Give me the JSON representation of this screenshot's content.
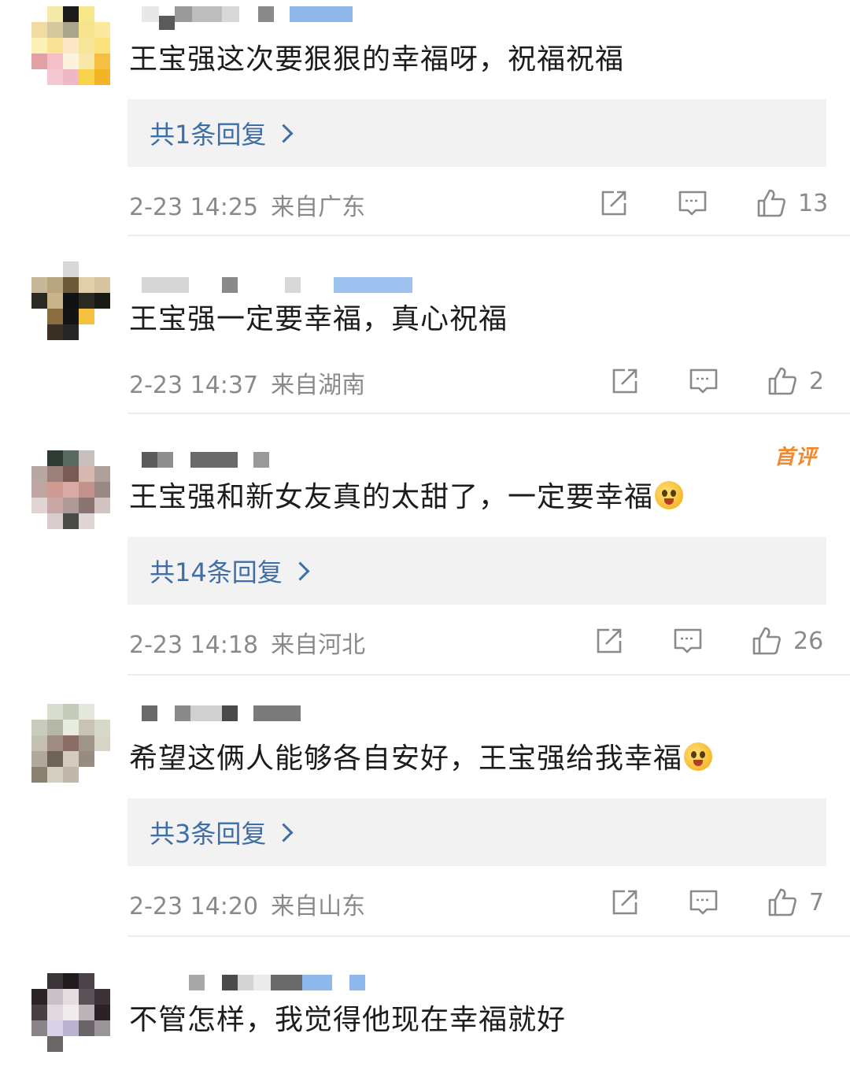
{
  "comments": [
    {
      "text": "王宝强这次要狠狠的幸福呀，祝福祝福",
      "replies": "共1条回复",
      "time": "2-23 14:25",
      "location": "来自广东",
      "likes": "13"
    },
    {
      "text": "王宝强一定要幸福，真心祝福",
      "replies": "",
      "time": "2-23 14:37",
      "location": "来自湖南",
      "likes": "2"
    },
    {
      "text": "王宝强和新女友真的太甜了，一定要幸福",
      "badge": "首评",
      "replies": "共14条回复",
      "time": "2-23 14:18",
      "location": "来自河北",
      "likes": "26"
    },
    {
      "text": "希望这俩人能够各自安好，王宝强给我幸福",
      "replies": "共3条回复",
      "time": "2-23 14:20",
      "location": "来自山东",
      "likes": "7"
    },
    {
      "text": "不管怎样，我觉得他现在幸福就好"
    }
  ],
  "icons": {
    "share": "share-icon",
    "comment": "comment-icon",
    "like": "thumbs-up-icon",
    "reply_arrow": "chevron-right-icon",
    "emoji": "face-emoji-icon"
  },
  "colors": {
    "link": "#3e6ea8",
    "meta": "#8a8a8a",
    "badge": "#f08a2c",
    "reply_bg": "#f2f2f2"
  }
}
